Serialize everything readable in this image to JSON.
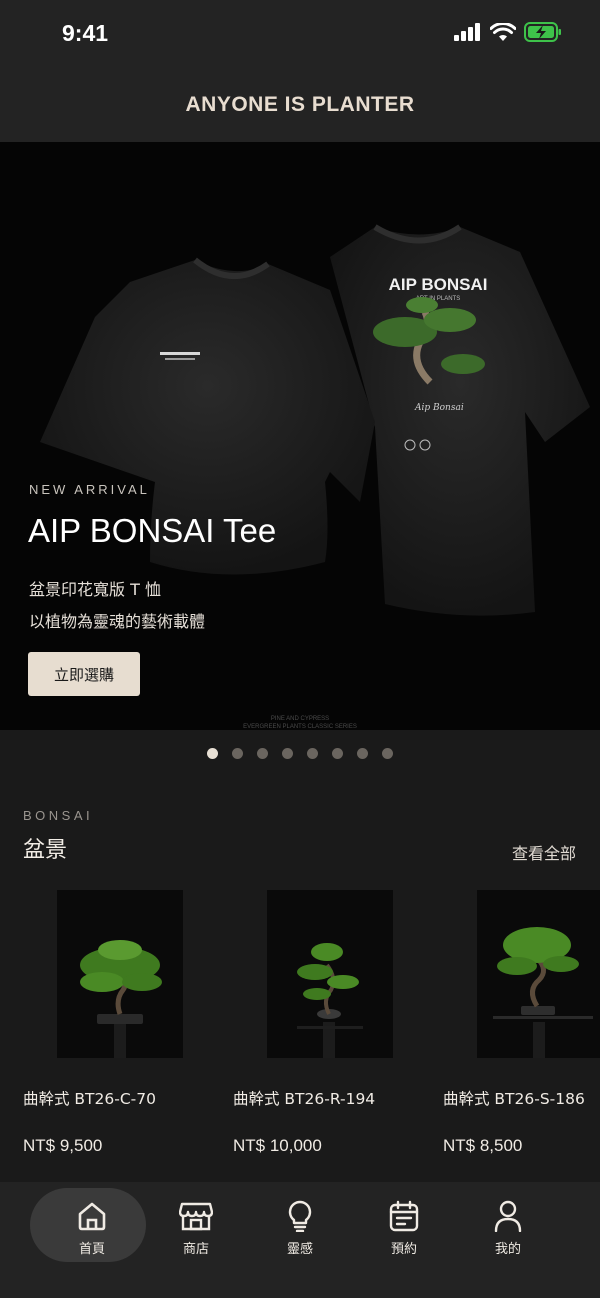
{
  "status_bar": {
    "time": "9:41"
  },
  "header": {
    "title": "ANYONE IS PLANTER"
  },
  "hero": {
    "eyebrow": "NEW ARRIVAL",
    "title": "AIP BONSAI Tee",
    "subtitle_line1": "盆景印花寬版 T 恤",
    "subtitle_line2": "以植物為靈魂的藝術載體",
    "cta_label": "立即選購",
    "shirt_print_title": "AIP BONSAI",
    "shirt_print_sub": "ART IN PLANTS",
    "footer_line1": "PINE AND CYPRESS",
    "footer_line2": "EVERGREEN PLANTS CLASSIC SERIES"
  },
  "carousel": {
    "slide_count": 8,
    "active_index": 0
  },
  "section": {
    "eyebrow": "BONSAI",
    "title": "盆景",
    "view_all_label": "查看全部"
  },
  "products": [
    {
      "name": "曲幹式 BT26-C-70",
      "price": "NT$ 9,500"
    },
    {
      "name": "曲幹式 BT26-R-194",
      "price": "NT$ 10,000"
    },
    {
      "name": "曲幹式 BT26-S-186",
      "price": "NT$ 8,500"
    }
  ],
  "bottom_nav": {
    "items": [
      {
        "label": "首頁",
        "icon": "home-icon"
      },
      {
        "label": "商店",
        "icon": "store-icon"
      },
      {
        "label": "靈感",
        "icon": "lightbulb-icon"
      },
      {
        "label": "預約",
        "icon": "calendar-icon"
      },
      {
        "label": "我的",
        "icon": "user-icon"
      }
    ],
    "active_index": 0
  },
  "colors": {
    "background": "#1a1a1a",
    "bar": "#232323",
    "accent": "#e7ddd0",
    "battery": "#3ec24a"
  }
}
